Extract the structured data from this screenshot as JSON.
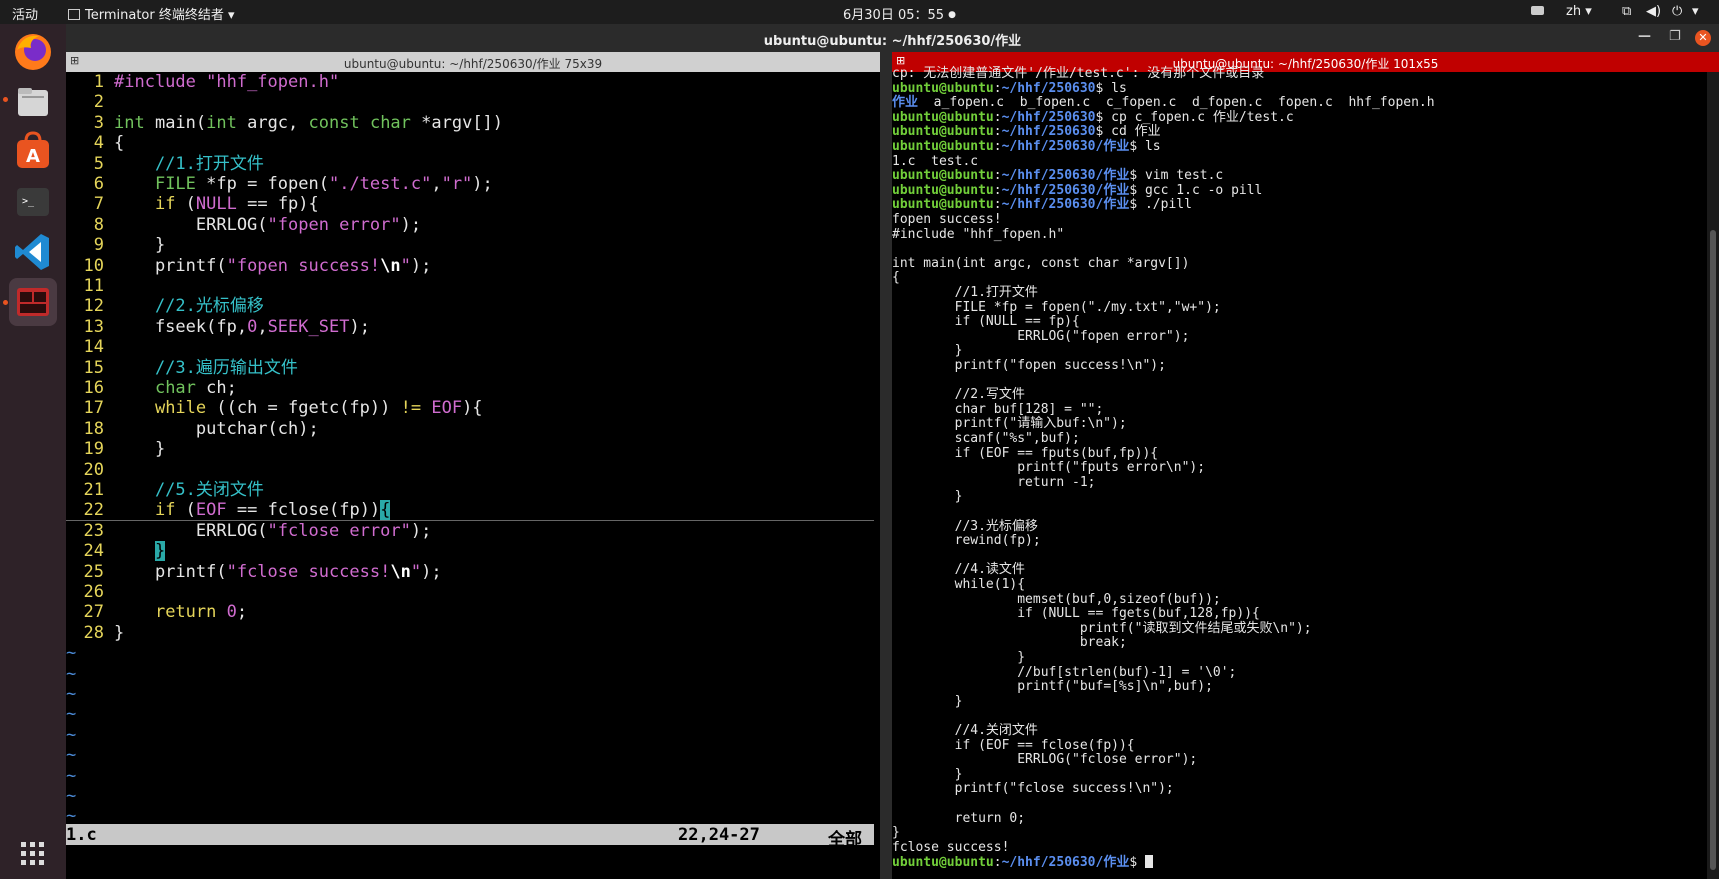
{
  "topbar": {
    "activities": "活动",
    "app_name": "Terminator 终端终结者",
    "datetime": "6月30日  05：55",
    "lang": "zh"
  },
  "window": {
    "title": "ubuntu@ubuntu: ~/hhf/250630/作业"
  },
  "left_pane": {
    "title": "ubuntu@ubuntu: ~/hhf/250630/作业 75x39",
    "status_file": "1.c",
    "status_pos": "22,24-27",
    "status_all": "全部",
    "lines": [
      "1",
      "2",
      "3",
      "4",
      "5",
      "6",
      "7",
      "8",
      "9",
      "10",
      "11",
      "12",
      "13",
      "14",
      "15",
      "16",
      "17",
      "18",
      "19",
      "20",
      "21",
      "22",
      "23",
      "24",
      "25",
      "26",
      "27",
      "28"
    ],
    "code": {
      "l1a": "#include ",
      "l1b": "\"hhf_fopen.h\"",
      "l3a": "int",
      "l3b": " main(",
      "l3c": "int",
      "l3d": " argc, ",
      "l3e": "const",
      "l3f": " ",
      "l3g": "char",
      "l3h": " *argv[])",
      "l4": "{",
      "l5": "    //1.打开文件",
      "l6a": "    ",
      "l6b": "FILE",
      "l6c": " *fp = fopen(",
      "l6d": "\"./test.c\"",
      "l6e": ",",
      "l6f": "\"r\"",
      "l6g": ");",
      "l7a": "    ",
      "l7b": "if",
      "l7c": " (",
      "l7d": "NULL",
      "l7e": " == fp){",
      "l8a": "        ERRLOG(",
      "l8b": "\"fopen error\"",
      "l8c": ");",
      "l9": "    }",
      "l10a": "    printf(",
      "l10b": "\"fopen success!",
      "l10c": "\\n",
      "l10d": "\"",
      "l10e": ");",
      "l12": "    //2.光标偏移",
      "l13a": "    fseek(fp,",
      "l13b": "0",
      "l13c": ",",
      "l13d": "SEEK_SET",
      "l13e": ");",
      "l15": "    //3.遍历输出文件",
      "l16a": "    ",
      "l16b": "char",
      "l16c": " ch;",
      "l17a": "    ",
      "l17b": "while",
      "l17c": " ((ch = fgetc(fp)) ",
      "l17d": "!=",
      "l17e": " ",
      "l17f": "EOF",
      "l17g": "){",
      "l18": "        putchar(ch);",
      "l19": "    }",
      "l21": "    //5.关闭文件",
      "l22a": "    ",
      "l22b": "if",
      "l22c": " (",
      "l22d": "EOF",
      "l22e": " == fclose(fp))",
      "l22f": "{",
      "l23a": "        ERRLOG(",
      "l23b": "\"fclose error\"",
      "l23c": ");",
      "l24a": "    ",
      "l24b": "}",
      "l25a": "    printf(",
      "l25b": "\"fclose success!",
      "l25c": "\\n",
      "l25d": "\"",
      "l25e": ");",
      "l27a": "    ",
      "l27b": "return",
      "l27c": " ",
      "l27d": "0",
      "l27e": ";",
      "l28": "}"
    },
    "tilde": "~"
  },
  "right_pane": {
    "title": "ubuntu@ubuntu: ~/hhf/250630/作业 101x55",
    "prompt_user": "ubuntu@ubuntu",
    "colon": ":",
    "path_base": "~/hhf/250630",
    "path_dir": "~/hhf/250630/作业",
    "dollar": "$ ",
    "out": {
      "cp_err": "cp: 无法创建普通文件'/作业/test.c': 没有那个文件或目录",
      "cmd_ls": "ls",
      "ls_dir": "作业",
      "ls_files": "  a_fopen.c  b_fopen.c  c_fopen.c  d_fopen.c  fopen.c  hhf_fopen.h",
      "cmd_cp": "cp c_fopen.c 作业/test.c",
      "cmd_cd": "cd 作业",
      "ls2": "1.c  test.c",
      "cmd_vim": "vim test.c",
      "cmd_gcc": "gcc 1.c -o pill",
      "cmd_run": "./pill",
      "o1": "fopen success!",
      "o2": "#include \"hhf_fopen.h\"",
      "o3": "",
      "o4": "int main(int argc, const char *argv[])",
      "o5": "{",
      "o6": "        //1.打开文件",
      "o7": "        FILE *fp = fopen(\"./my.txt\",\"w+\");",
      "o8": "        if (NULL == fp){",
      "o9": "                ERRLOG(\"fopen error\");",
      "o10": "        }",
      "o11": "        printf(\"fopen success!\\n\");",
      "o12": "",
      "o13": "        //2.写文件",
      "o14": "        char buf[128] = \"\";",
      "o15": "        printf(\"请输入buf:\\n\");",
      "o16": "        scanf(\"%s\",buf);",
      "o17": "        if (EOF == fputs(buf,fp)){",
      "o18": "                printf(\"fputs error\\n\");",
      "o19": "                return -1;",
      "o20": "        }",
      "o21": "",
      "o22": "        //3.光标偏移",
      "o23": "        rewind(fp);",
      "o24": "",
      "o25": "        //4.读文件",
      "o26": "        while(1){",
      "o27": "                memset(buf,0,sizeof(buf));",
      "o28": "                if (NULL == fgets(buf,128,fp)){",
      "o29": "                        printf(\"读取到文件结尾或失败\\n\");",
      "o30": "                        break;",
      "o31": "                }",
      "o32": "                //buf[strlen(buf)-1] = '\\0';",
      "o33": "                printf(\"buf=[%s]\\n\",buf);",
      "o34": "        }",
      "o35": "",
      "o36": "        //4.关闭文件",
      "o37": "        if (EOF == fclose(fp)){",
      "o38": "                ERRLOG(\"fclose error\");",
      "o39": "        }",
      "o40": "        printf(\"fclose success!\\n\");",
      "o41": "",
      "o42": "        return 0;",
      "o43": "}",
      "o44": "fclose success!"
    }
  },
  "colors": {
    "accent_red": "#c00000",
    "prompt_green": "#72cf3a",
    "prompt_blue": "#5b8ff0"
  }
}
